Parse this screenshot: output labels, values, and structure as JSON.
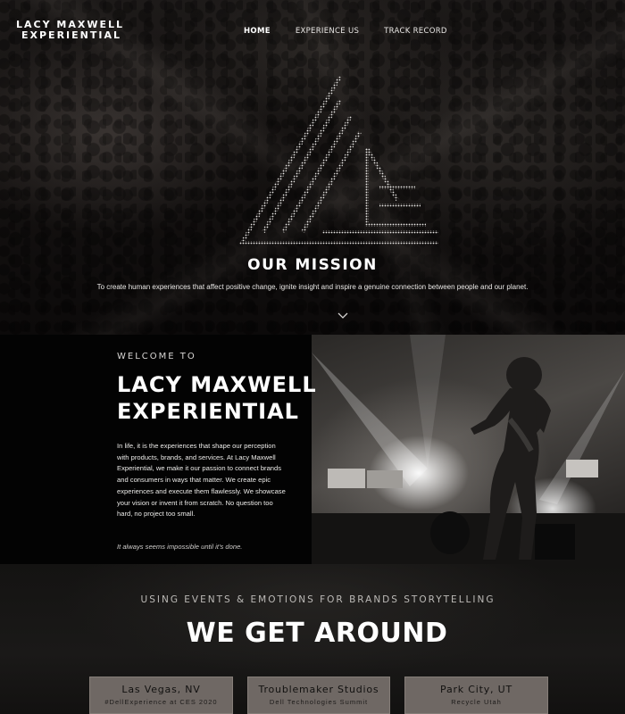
{
  "brand": {
    "line1": "LACY MAXWELL",
    "line2": "EXPERIENTIAL"
  },
  "nav": {
    "items": [
      "HOME",
      "EXPERIENCE US",
      "TRACK RECORD"
    ],
    "active": "HOME"
  },
  "hero": {
    "mission_title": "OUR MISSION",
    "mission_text": "To create human experiences that affect positive change, ignite insight and inspire a genuine connection between people and our planet."
  },
  "welcome": {
    "kicker": "WELCOME TO",
    "title_line1": "LACY MAXWELL",
    "title_line2": "EXPERIENTIAL",
    "body": "In life, it is the experiences that shape our perception with products, brands, and services. At Lacy Maxwell Experiential, we make it our passion to connect brands and consumers in ways that matter. We create epic experiences and execute them flawlessly. We showcase your vision or invent it from scratch. No question too hard, no project too small.",
    "tagline": "It always seems impossible until it’s done."
  },
  "events": {
    "kicker": "USING EVENTS & EMOTIONS FOR BRANDS STORYTELLING",
    "title": "WE GET AROUND",
    "cards": [
      {
        "title": "Las Vegas, NV",
        "subtitle": "#DellExperience at CES 2020"
      },
      {
        "title": "Troublemaker Studios",
        "subtitle": "Dell Technologies Summit"
      },
      {
        "title": "Park City, UT",
        "subtitle": "Recycle Utah"
      }
    ]
  },
  "colors": {
    "page_bg": "#0b0a0a",
    "card_bg": "#6f6864",
    "text": "#ffffff"
  },
  "icons": {
    "chevron": "chevron-down-icon",
    "logo_mark": "triangle-logo-mark"
  }
}
